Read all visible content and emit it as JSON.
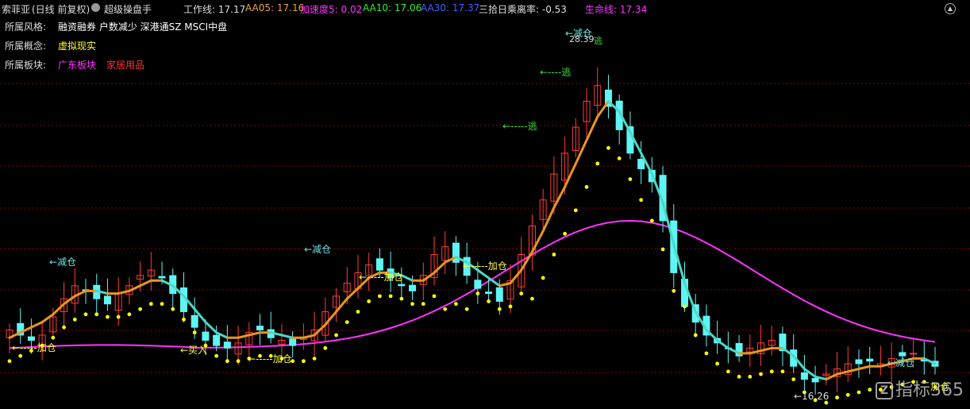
{
  "header": {
    "stock": "索菲亚",
    "period": "(日线 前复权)",
    "circle_icon": "settings-circle-icon",
    "indicator": "超级操盘手",
    "items": [
      {
        "text": "工作线: 17.17",
        "color": "#dddddd"
      },
      {
        "text": "AA05: 17.16",
        "color": "#e8a23a"
      },
      {
        "text": "加速度5: 0.02",
        "color": "#ff33ff"
      },
      {
        "text": "AA10: 17.06",
        "color": "#33ee33"
      },
      {
        "text": "AA30: 17.37",
        "color": "#4060ff"
      },
      {
        "text": "三拾日乘离率: -0.53",
        "color": "#dddddd"
      },
      {
        "text": "生命线: 17.34",
        "color": "#ff33ff"
      }
    ]
  },
  "info": [
    {
      "label": "所属风格:",
      "values": [
        {
          "text": "融资融券 户数减少 深港通SZ MSCI中盘",
          "color": "#ffffff"
        }
      ]
    },
    {
      "label": "所属概念:",
      "values": [
        {
          "text": "虚拟现实",
          "color": "#ffff33"
        }
      ]
    },
    {
      "label": "所属板块:",
      "values": [
        {
          "text": "广东板块",
          "color": "#ff33ff"
        },
        {
          "text": "家居用品",
          "color": "#ff3333"
        }
      ]
    }
  ],
  "annotations": [
    {
      "text": "←减仓",
      "color": "#66e0e0"
    },
    {
      "text": "←-----加仓",
      "color": "#ffff33"
    },
    {
      "text": "←买入",
      "color": "#ffff33"
    },
    {
      "text": "←-----加仓",
      "color": "#ffff33"
    },
    {
      "text": "←减仓",
      "color": "#66e0e0"
    },
    {
      "text": "←-----加仓",
      "color": "#ffff33"
    },
    {
      "text": "←-----加仓",
      "color": "#ffff33"
    },
    {
      "text": "←减仓",
      "color": "#66e0e0"
    },
    {
      "text": "28.39",
      "color": "#dddddd"
    },
    {
      "text": "逃",
      "color": "#33dd33"
    },
    {
      "text": "←----逃",
      "color": "#33dd33"
    },
    {
      "text": "←-----逃",
      "color": "#33dd33"
    },
    {
      "text": "←16.26",
      "color": "#dddddd"
    },
    {
      "text": "←减仓",
      "color": "#66e0e0"
    },
    {
      "text": "加仓",
      "color": "#ffff33"
    }
  ],
  "collapse_icon": "chevron-up-icon",
  "logo": {
    "text": "指标365",
    "mark": "Z"
  },
  "colors": {
    "up": "#ff3c3c",
    "down": "#5ff5f5",
    "mid_line_up": "#e8961e",
    "mid_line_down": "#4ad9c8",
    "dots": "#ffff00",
    "life_line": "#ff33ff",
    "grid": "#8b0000"
  },
  "chart_data": {
    "type": "candlestick",
    "y_high": 28.39,
    "y_low": 16.26,
    "closes": [
      18.6,
      18.4,
      18.2,
      18.4,
      19.1,
      19.8,
      20.3,
      20.1,
      19.8,
      19.6,
      20.0,
      20.3,
      20.7,
      20.9,
      20.6,
      20.0,
      19.3,
      18.7,
      18.2,
      18.0,
      17.9,
      18.1,
      18.5,
      18.6,
      18.3,
      18.2,
      18.0,
      18.3,
      18.6,
      19.3,
      19.9,
      20.4,
      20.8,
      21.1,
      20.9,
      20.6,
      20.3,
      20.1,
      20.7,
      21.5,
      21.8,
      21.2,
      20.7,
      20.2,
      20.0,
      19.7,
      20.5,
      21.5,
      22.6,
      23.6,
      24.6,
      25.4,
      26.4,
      27.4,
      28.0,
      27.2,
      26.3,
      25.4,
      24.8,
      24.3,
      22.8,
      20.8,
      19.5,
      18.9,
      18.4,
      18.1,
      17.9,
      17.6,
      17.9,
      18.1,
      18.2,
      17.8,
      17.2,
      16.7,
      16.6,
      16.9,
      17.1,
      17.3,
      17.3,
      17.4,
      17.3,
      17.5,
      17.6,
      17.7,
      17.4,
      17.2
    ],
    "ma_mid": [
      18.3,
      18.5,
      18.7,
      18.9,
      19.2,
      19.6,
      19.9,
      20.1,
      20.1,
      20.0,
      20.0,
      20.1,
      20.3,
      20.5,
      20.5,
      20.3,
      19.9,
      19.4,
      18.9,
      18.5,
      18.3,
      18.3,
      18.4,
      18.5,
      18.5,
      18.4,
      18.3,
      18.3,
      18.4,
      18.8,
      19.3,
      19.8,
      20.2,
      20.6,
      20.8,
      20.8,
      20.7,
      20.5,
      20.5,
      20.8,
      21.2,
      21.4,
      21.2,
      20.9,
      20.6,
      20.3,
      20.4,
      20.9,
      21.6,
      22.4,
      23.3,
      24.1,
      25.0,
      25.9,
      26.8,
      27.4,
      27.0,
      26.2,
      25.4,
      24.6,
      23.5,
      21.9,
      20.4,
      19.3,
      18.6,
      18.2,
      17.9,
      17.7,
      17.7,
      17.8,
      17.9,
      17.9,
      17.6,
      17.1,
      16.8,
      16.7,
      16.9,
      17.0,
      17.1,
      17.2,
      17.2,
      17.3,
      17.4,
      17.5,
      17.5,
      17.3
    ]
  }
}
